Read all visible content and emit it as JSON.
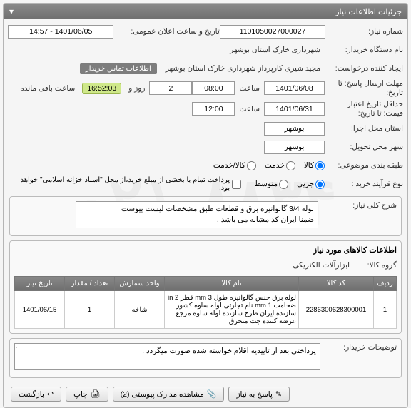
{
  "watermark": "۰۲۱-۸۸۳۴",
  "panel": {
    "title": "جزئیات اطلاعات نیاز",
    "collapse_icon": "▾"
  },
  "rows": {
    "need_no_label": "شماره نیاز:",
    "need_no_value": "1101050027000027",
    "announce_label": "تاریخ و ساعت اعلان عمومی:",
    "announce_value": "1401/06/05 - 14:57",
    "buyer_org_label": "نام دستگاه خریدار:",
    "buyer_org_value": "شهرداری خارک استان بوشهر",
    "requester_label": "ایجاد کننده درخواست:",
    "requester_value": "مجید شیری کارپرداز شهرداری خارک استان بوشهر",
    "contact_tag": "اطلاعات تماس خریدار",
    "send_resp_label": "مهلت ارسال پاسخ: تا تاریخ:",
    "send_resp_date": "1401/06/08",
    "hour_word": "ساعت",
    "send_resp_hour": "08:00",
    "days_count": "2",
    "day_and": "روز و",
    "timer_value": "16:52:03",
    "remain_text": "ساعت باقی مانده",
    "validity_label": "حداقل تاریخ اعتبار قیمت: تا تاریخ:",
    "validity_date": "1401/06/31",
    "validity_hour": "12:00",
    "exec_prov_label": "استان محل اجرا:",
    "exec_prov_value": "بوشهر",
    "deliv_city_label": "شهر محل تحویل:",
    "deliv_city_value": "بوشهر",
    "subject_cat_label": "طبقه بندی موضوعی:",
    "kala_opt": "کالا",
    "khadmat_opt": "خدمت",
    "kalakhadmat_opt": "کالا/خدمت",
    "buy_proc_label": "نوع فرآیند خرید :",
    "partial_opt": "جزیی",
    "medium_opt": "متوسط",
    "buy_note": "پرداخت تمام یا بخشی از مبلغ خرید،از محل \"اسناد خزانه اسلامی\" خواهد بود.",
    "need_desc_label": "شرح کلی نیاز:",
    "need_desc_value": "لوله 3/4 گالوانیزه برق و قطعات طبق مشخصات لیست پیوست\nضمنا ایران کد مشابه می باشد .",
    "goods_heading": "اطلاعات کالاهای مورد نیاز",
    "goods_group_label": "گروه کالا:",
    "goods_group_value": "ابزارآلات الکتریکی"
  },
  "cols": {
    "row": "ردیف",
    "code": "کد کالا",
    "name": "نام کالا",
    "unit": "واحد شمارش",
    "qty": "تعداد / مقدار",
    "date": "تاریخ نیاز"
  },
  "items": [
    {
      "row": "1",
      "code": "2286300628300001",
      "name": "لوله برق جنس گالوانیزه طول mm 3 قطر in 2 ضخامت mm 1 نام تجارتی لوله ساوه کشور سازنده ایران طرح سازنده لوله ساوه مرجع عرضه کننده جت متحرق",
      "unit": "شاخه",
      "qty": "1",
      "date": "1401/06/15"
    }
  ],
  "buyer_notes_label": "توضیحات خریدار:",
  "buyer_notes_value": "پرداختی بعد از تاییدیه اقلام خواسته شده صورت میگردد .",
  "buttons": {
    "reply": "پاسخ به نیاز",
    "attach": "مشاهده مدارک پیوستی (2)",
    "print": "چاپ",
    "back": "بازگشت"
  }
}
